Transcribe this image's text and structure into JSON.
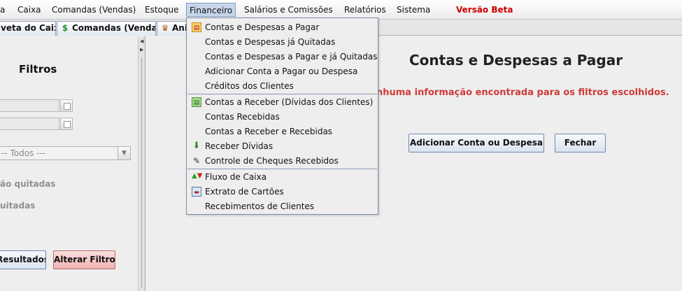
{
  "menubar": {
    "items": [
      "a",
      "Caixa",
      "Comandas (Vendas)",
      "Estoque",
      "Financeiro",
      "Salários e Comissões",
      "Relatórios",
      "Sistema"
    ],
    "beta": "Versão Beta"
  },
  "tabs": [
    {
      "label": "veta do Caixa",
      "icon": ""
    },
    {
      "label": "Comandas (Vendas)",
      "icon": "dollar-icon"
    },
    {
      "label": "Ani",
      "icon": "crown-icon"
    }
  ],
  "left": {
    "title": "Filtros",
    "select_value": "-- Todos ---",
    "check1": "ão quitadas",
    "check2": "uitadas",
    "btn_results": "Resultados",
    "btn_alter": "Alterar Filtros"
  },
  "main": {
    "title": "Contas e Despesas a Pagar",
    "info": "nhuma informação encontrada para os filtros escolhidos.",
    "btn_add": "Adicionar Conta ou Despesa",
    "btn_close": "Fechar"
  },
  "dropdown": {
    "items": [
      {
        "label": "Contas e Despesas a Pagar",
        "icon": "bill-icon"
      },
      {
        "label": "Contas e Despesas já Quitadas",
        "icon": ""
      },
      {
        "label": "Contas e Despesas a Pagar e já Quitadas",
        "icon": ""
      },
      {
        "label": "Adicionar Conta a Pagar ou Despesa",
        "icon": ""
      },
      {
        "label": "Créditos dos Clientes",
        "icon": ""
      },
      {
        "label": "Contas a Receber (Dívidas dos Clientes)",
        "icon": "receivable-icon"
      },
      {
        "label": "Contas Recebidas",
        "icon": ""
      },
      {
        "label": "Contas a Receber e Recebidas",
        "icon": ""
      },
      {
        "label": "Receber Dívidas",
        "icon": "money-bag-icon"
      },
      {
        "label": "Controle de Cheques Recebidos",
        "icon": "pen-icon"
      },
      {
        "label": "Fluxo de Caixa",
        "icon": "cash-flow-icon"
      },
      {
        "label": "Extrato de Cartões",
        "icon": "card-statement-icon"
      },
      {
        "label": "Recebimentos de Clientes",
        "icon": ""
      }
    ]
  }
}
